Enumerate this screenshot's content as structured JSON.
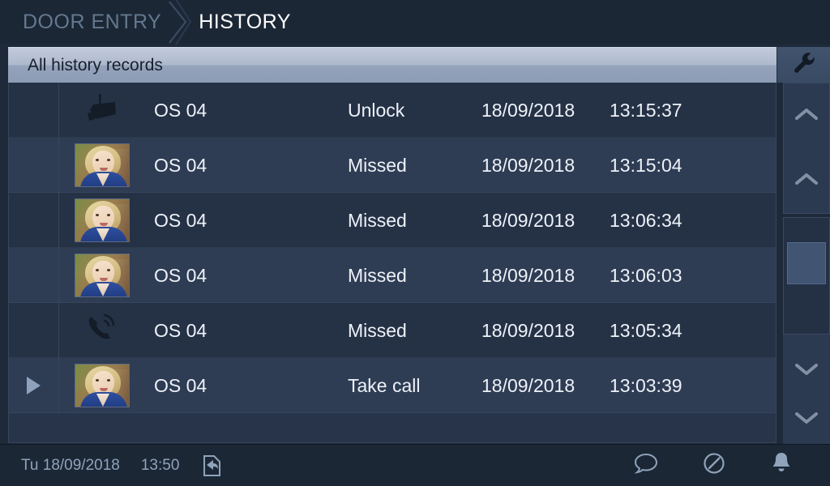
{
  "breadcrumb": {
    "parent": "DOOR ENTRY",
    "separator_icon": "chevron-right-icon",
    "current": "HISTORY"
  },
  "toolbar": {
    "title": "All history records",
    "settings_icon": "wrench-icon"
  },
  "list": {
    "columns": [
      "icon",
      "name",
      "event",
      "date",
      "time"
    ],
    "rows": [
      {
        "icon": "security-camera-icon",
        "thumb": false,
        "play": false,
        "name": "OS 04",
        "event": "Unlock",
        "date": "18/09/2018",
        "time": "13:15:37"
      },
      {
        "icon": "photo-thumbnail",
        "thumb": true,
        "play": false,
        "name": "OS 04",
        "event": "Missed",
        "date": "18/09/2018",
        "time": "13:15:04"
      },
      {
        "icon": "photo-thumbnail",
        "thumb": true,
        "play": false,
        "name": "OS 04",
        "event": "Missed",
        "date": "18/09/2018",
        "time": "13:06:34"
      },
      {
        "icon": "photo-thumbnail",
        "thumb": true,
        "play": false,
        "name": "OS 04",
        "event": "Missed",
        "date": "18/09/2018",
        "time": "13:06:03"
      },
      {
        "icon": "ringing-phone-icon",
        "thumb": false,
        "play": false,
        "name": "OS 04",
        "event": "Missed",
        "date": "18/09/2018",
        "time": "13:05:34"
      },
      {
        "icon": "photo-thumbnail",
        "thumb": true,
        "play": true,
        "name": "OS 04",
        "event": "Take call",
        "date": "18/09/2018",
        "time": "13:03:39"
      }
    ]
  },
  "scrollbar": {
    "up_fast_icon": "chevron-up-icon",
    "up_icon": "chevron-up-icon",
    "down_icon": "chevron-down-icon",
    "down_fast_icon": "chevron-down-icon"
  },
  "footer": {
    "date": "Tu 18/09/2018",
    "time": "13:50",
    "forward_icon": "call-forward-icon",
    "message_icon": "speech-bubble-icon",
    "dnd_icon": "do-not-disturb-icon",
    "bell_icon": "bell-icon"
  },
  "colors": {
    "background": "#1e2a3a",
    "row_dark": "#253246",
    "row_light": "#2e3c54",
    "title_bar": "#aeb9cd",
    "text_primary": "#eef2f8",
    "text_muted": "#64788e",
    "footer_text": "#8fa3ba",
    "scroll_thumb": "#415573"
  }
}
